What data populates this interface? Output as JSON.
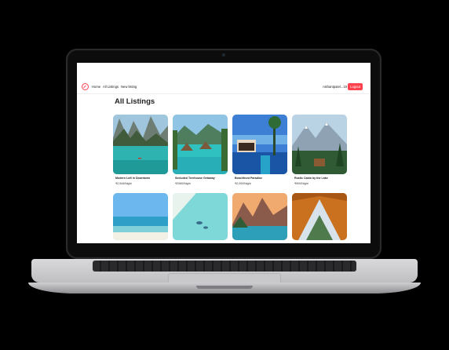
{
  "nav": {
    "links": [
      "Home",
      "All Listings",
      "New listing"
    ],
    "user": "nishantpatel...19",
    "logout": "Logout"
  },
  "page": {
    "title": "All Listings"
  },
  "listings": [
    {
      "name": "Modern Loft in Downtown",
      "price": "₹2,544/Night"
    },
    {
      "name": "Secluded Treehouse Getaway",
      "price": "₹2060/Night"
    },
    {
      "name": "Beachfront Paradise",
      "price": "₹2,000/Night"
    },
    {
      "name": "Rustic Cabin by the Lake",
      "price": "₹900/Night"
    },
    {
      "name": "",
      "price": ""
    },
    {
      "name": "",
      "price": ""
    },
    {
      "name": "",
      "price": ""
    },
    {
      "name": "",
      "price": ""
    }
  ],
  "colors": {
    "accent": "#fe424d"
  }
}
